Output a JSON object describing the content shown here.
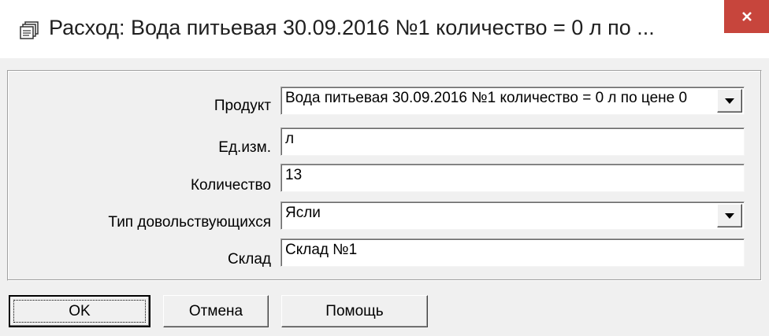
{
  "window": {
    "title": "Расход: Вода питьевая 30.09.2016  №1 количество = 0 л по ...",
    "title_icon": "stack-of-papers-icon",
    "close_icon": "close-icon",
    "close_color": "#c7453c"
  },
  "form": {
    "product": {
      "label": "Продукт",
      "value": "Вода питьевая 30.09.2016  №1 количество = 0 л по цене 0"
    },
    "unit": {
      "label": "Ед.изм.",
      "value": "л"
    },
    "quantity": {
      "label": "Количество",
      "value": "13"
    },
    "consumer_type": {
      "label": "Тип довольствующихся",
      "value": "Ясли"
    },
    "warehouse": {
      "label": "Склад",
      "value": "Склад №1"
    },
    "dropdown_icon": "triangle-down-icon"
  },
  "buttons": {
    "ok": "OK",
    "cancel": "Отмена",
    "help": "Помощь"
  }
}
